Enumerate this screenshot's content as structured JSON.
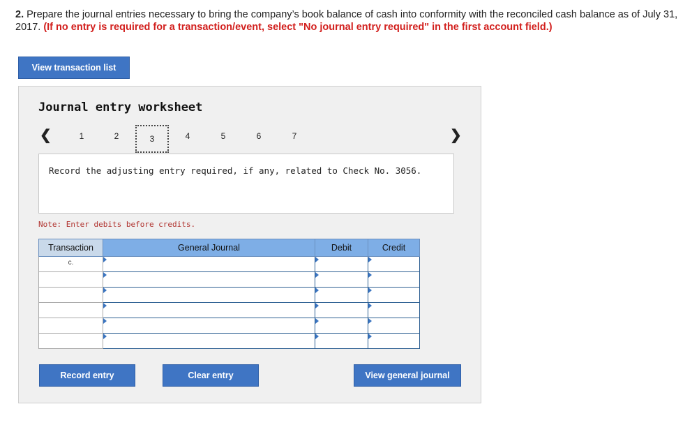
{
  "question": {
    "number": "2.",
    "text": "Prepare the journal entries necessary to bring the company’s book balance of cash into conformity with the reconciled cash balance as of July 31, 2017.",
    "instruction": "(If no entry is required for a transaction/event, select \"No journal entry required\" in the first account field.)"
  },
  "buttons": {
    "view_transaction_list": "View transaction list",
    "record_entry": "Record entry",
    "clear_entry": "Clear entry",
    "view_general_journal": "View general journal"
  },
  "worksheet": {
    "title": "Journal entry worksheet",
    "steps": [
      "1",
      "2",
      "3",
      "4",
      "5",
      "6",
      "7"
    ],
    "active_step": "3",
    "prompt": "Record the adjusting entry required, if any, related to Check No. 3056.",
    "note": "Note: Enter debits before credits."
  },
  "table": {
    "headers": {
      "transaction": "Transaction",
      "general_journal": "General Journal",
      "debit": "Debit",
      "credit": "Credit"
    },
    "rows": [
      {
        "transaction": "c.",
        "account": "",
        "debit": "",
        "credit": ""
      },
      {
        "transaction": "",
        "account": "",
        "debit": "",
        "credit": ""
      },
      {
        "transaction": "",
        "account": "",
        "debit": "",
        "credit": ""
      },
      {
        "transaction": "",
        "account": "",
        "debit": "",
        "credit": ""
      },
      {
        "transaction": "",
        "account": "",
        "debit": "",
        "credit": ""
      },
      {
        "transaction": "",
        "account": "",
        "debit": "",
        "credit": ""
      }
    ]
  },
  "icons": {
    "prev": "chevron-left-icon",
    "next": "chevron-right-icon"
  },
  "colors": {
    "button": "#3f75c4",
    "header": "#7eaee6",
    "instruction": "#d2201e",
    "note": "#b0312d"
  }
}
